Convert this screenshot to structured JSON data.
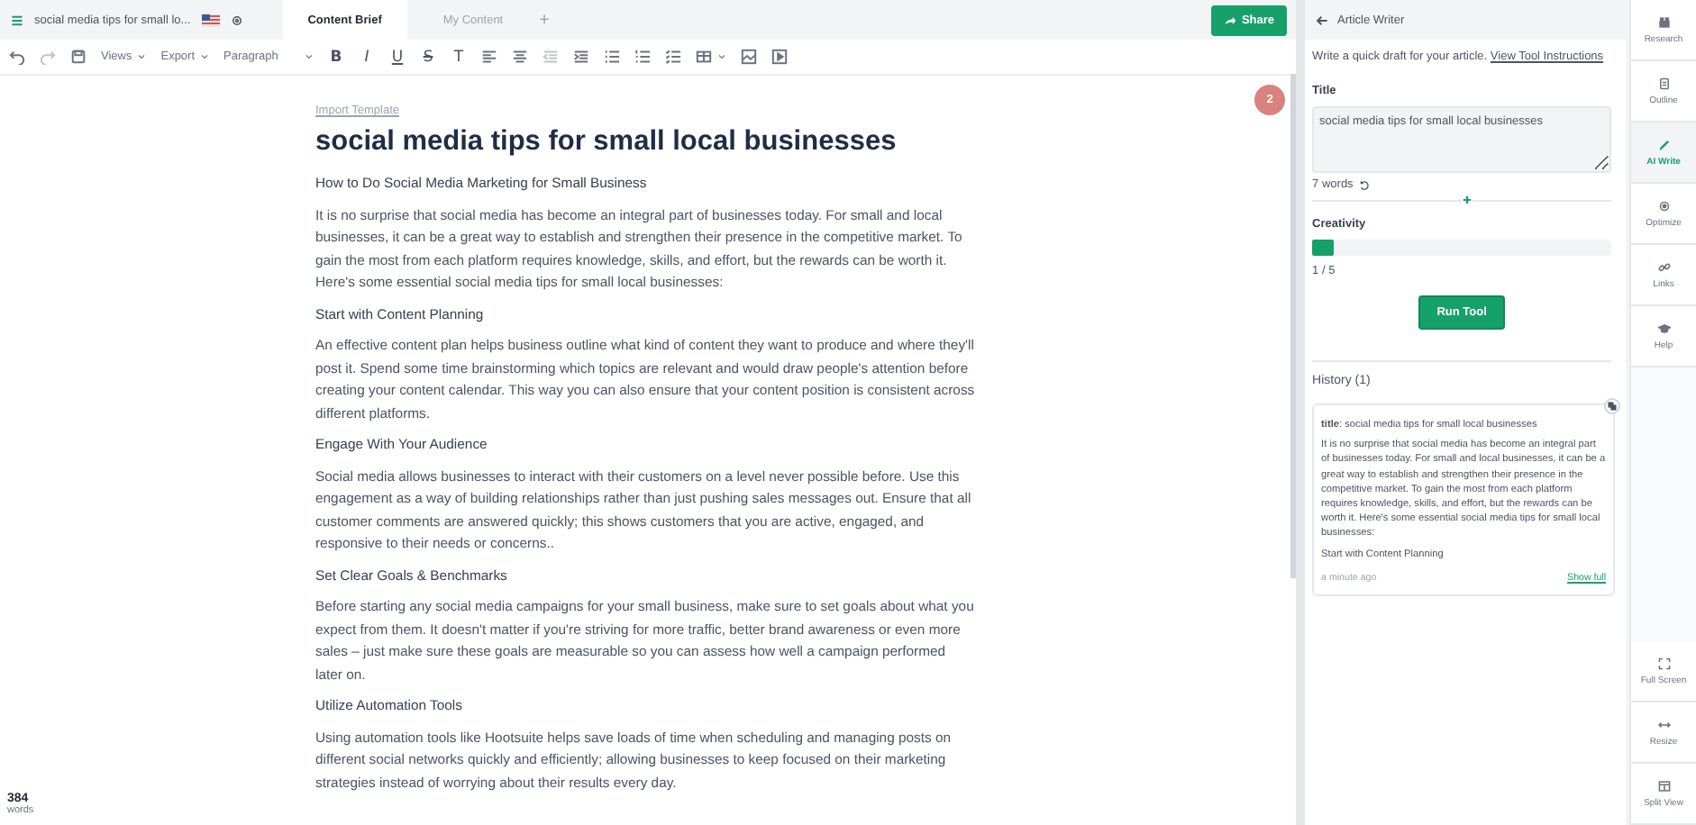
{
  "top_bar": {
    "document_title": "social media tips for small lo...",
    "tabs": [
      {
        "label": "Content Brief",
        "selected": true
      },
      {
        "label": "My Content",
        "selected": false
      }
    ],
    "add_tab": "+",
    "share_button": "Share"
  },
  "toolbar": {
    "menus": [
      "Views",
      "Export"
    ],
    "block_format": "Paragraph",
    "format_buttons": [
      "B",
      "I",
      "U",
      "S",
      "T"
    ]
  },
  "editor": {
    "import_link": "Import Template",
    "title": "social media tips for small local businesses",
    "badge": "2",
    "blocks": [
      {
        "kind": "heading",
        "text": "How to Do Social Media Marketing for Small Business"
      },
      {
        "kind": "paragraph",
        "text": "It is no surprise that social media has become an integral part of businesses today. For small and local businesses, it can be a great way to establish and strengthen their presence in the competitive market. To gain the most from each platform requires knowledge, skills, and effort, but the rewards can be worth it. Here's some essential social media tips for small local businesses:"
      },
      {
        "kind": "heading",
        "text": "Start with Content Planning"
      },
      {
        "kind": "paragraph",
        "text": "An effective content plan helps business outline what kind of content they want to produce and where they'll post it. Spend some time brainstorming which topics are relevant and would draw people's attention before creating your content calendar. This way you can also ensure that your content position is consistent across different platforms."
      },
      {
        "kind": "heading",
        "text": "Engage With Your Audience"
      },
      {
        "kind": "paragraph",
        "text": "Social media allows businesses to interact with their customers on a level never possible before. Use this engagement as a way of building relationships rather than just pushing sales messages out. Ensure that all customer comments are answered quickly; this shows customers that you are active, engaged, and responsive to their needs or concerns.."
      },
      {
        "kind": "heading",
        "text": "Set Clear Goals & Benchmarks"
      },
      {
        "kind": "paragraph",
        "text": "Before starting any social media campaigns for your small business, make sure to set goals about what you expect from them. It doesn't matter if you're striving for more traffic, better brand awareness or even more sales – just make sure these goals are measurable so you can assess how well a campaign performed later on."
      },
      {
        "kind": "heading",
        "text": "Utilize Automation Tools"
      },
      {
        "kind": "paragraph",
        "text": "Using automation tools like Hootsuite helps save loads of time when scheduling and managing posts on different social networks quickly and efficiently; allowing businesses to keep focused on their marketing strategies instead of worrying about their results every day."
      }
    ],
    "word_count": "384",
    "word_count_label": "words"
  },
  "panel": {
    "header": "Article Writer",
    "description": "Write a quick draft for your article.",
    "instructions_link": "View Tool Instructions",
    "title_label": "Title",
    "title_value": "social media tips for small local businesses",
    "title_word_count": "7 words",
    "creativity_label": "Creativity",
    "creativity": {
      "level": 0.07
    },
    "creativity_reading": "1 / 5",
    "run_button": "Run Tool",
    "history_label": "History (1)",
    "history": [
      {
        "title": "**title**: social media tips for small local businesses",
        "body": "It is no surprise that social media has become an integral part of businesses today. For small and local businesses, it can be a great way to establish and strengthen their presence in the competitive market. To gain the most from each platform requires knowledge, skills, and effort, but the rewards can be worth it. Here's some essential social media tips for small local businesses:",
        "heading": "Start with Content Planning",
        "time": "a minute ago",
        "link": "Show full"
      }
    ]
  },
  "rail": {
    "items": [
      {
        "kind": "research",
        "label": "Research",
        "selected": false
      },
      {
        "kind": "outline",
        "label": "Outline",
        "selected": false
      },
      {
        "kind": "write",
        "label": "AI Write",
        "selected": true
      },
      {
        "kind": "optimize",
        "label": "Optimize",
        "selected": false
      },
      {
        "kind": "links",
        "label": "Links",
        "selected": false
      },
      {
        "kind": "help",
        "label": "Help",
        "selected": false
      }
    ],
    "bottom_items": [
      {
        "kind": "fullscreen",
        "label": "Full Screen"
      },
      {
        "kind": "resize",
        "label": "Resize"
      },
      {
        "kind": "split",
        "label": "Split View"
      }
    ]
  }
}
